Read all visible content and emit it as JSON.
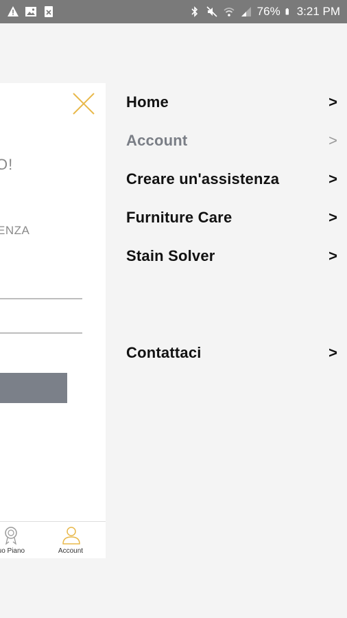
{
  "status_bar": {
    "battery": "76%",
    "time": "3:21 PM"
  },
  "background_page": {
    "heading_fragment": "O!",
    "subheading_fragment": "ENZA",
    "tabs": [
      {
        "label": "tuo Piano",
        "icon": "badge-icon"
      },
      {
        "label": "Account",
        "icon": "user-icon"
      }
    ]
  },
  "menu": {
    "items": [
      {
        "label": "Home",
        "arrow": ">"
      },
      {
        "label": "Account",
        "arrow": ">"
      },
      {
        "label": "Creare un'assistenza",
        "arrow": ">"
      },
      {
        "label": "Furniture Care",
        "arrow": ">"
      },
      {
        "label": "Stain Solver",
        "arrow": ">"
      },
      {
        "label": "Contattaci",
        "arrow": ">"
      }
    ]
  },
  "colors": {
    "accent": "#e8b84a",
    "selected_text": "#7a7e86",
    "status_bar": "#7a7a7a"
  }
}
